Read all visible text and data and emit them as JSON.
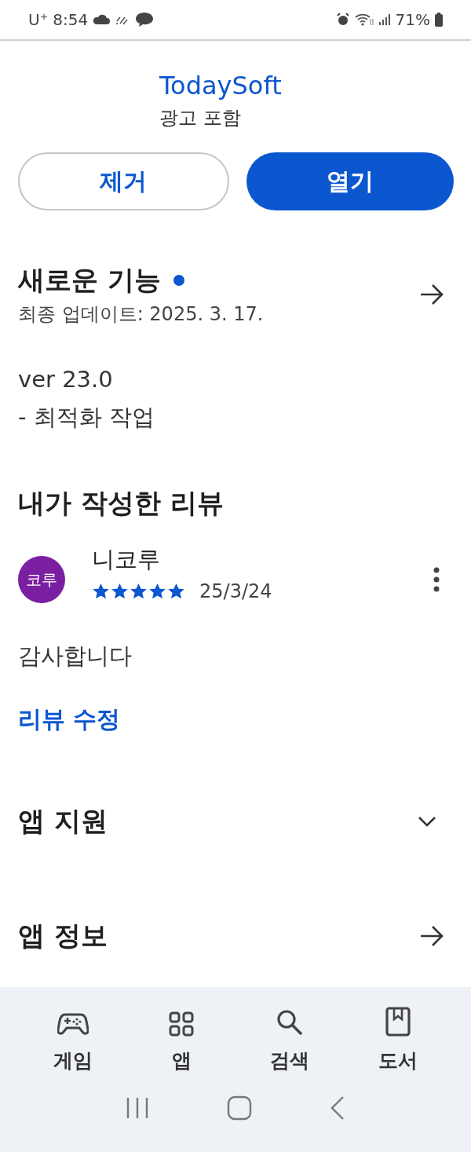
{
  "status_bar": {
    "carrier": "U⁺",
    "time": "8:54",
    "battery": "71%"
  },
  "app": {
    "developer": "TodaySoft",
    "note": "광고 포함"
  },
  "actions": [
    {
      "label": "제거",
      "kind": "outline"
    },
    {
      "label": "열기",
      "kind": "filled"
    }
  ],
  "whats_new": {
    "title": "새로운 기능",
    "new_dot": true,
    "updated": "최종 업데이트: 2025. 3. 17.",
    "lines": [
      "ver 23.0",
      "- 최적화 작업"
    ]
  },
  "my_review": {
    "title": "내가 작성한 리뷰",
    "avatar_text": "코루",
    "author": "니코루",
    "stars": 5,
    "date": "25/3/24",
    "text": "감사합니다",
    "edit_link": "리뷰 수정"
  },
  "sections": [
    {
      "title": "앱 지원",
      "kind": "expand"
    },
    {
      "title": "앱 정보",
      "kind": "arrow"
    }
  ],
  "bottom_nav": [
    {
      "label": "게임",
      "kind": "games"
    },
    {
      "label": "앱",
      "kind": "apps"
    },
    {
      "label": "검색",
      "kind": "search"
    },
    {
      "label": "도서",
      "kind": "books"
    }
  ]
}
